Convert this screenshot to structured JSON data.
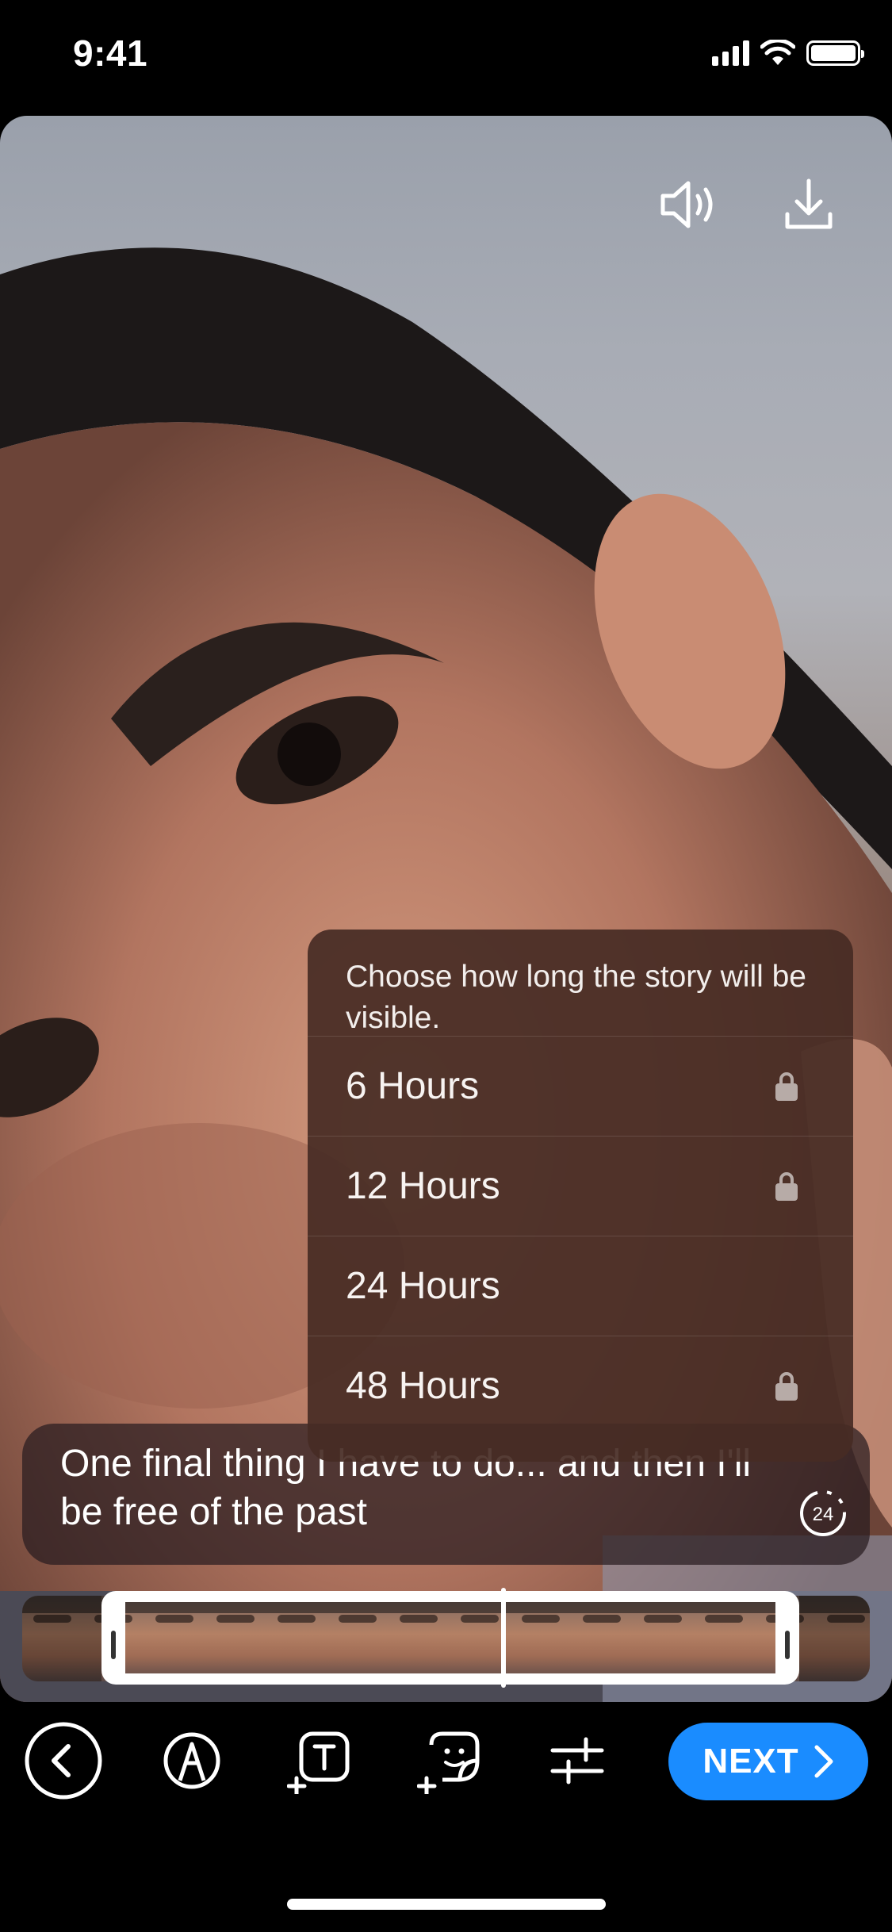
{
  "status_bar": {
    "time": "9:41"
  },
  "media": {
    "sound_icon": "speaker-icon",
    "download_icon": "download-icon"
  },
  "duration_menu": {
    "title": "Choose how long the story will be visible.",
    "options": [
      {
        "label": "6 Hours",
        "locked": true
      },
      {
        "label": "12 Hours",
        "locked": true
      },
      {
        "label": "24 Hours",
        "locked": false
      },
      {
        "label": "48 Hours",
        "locked": true
      }
    ]
  },
  "caption": {
    "text": "One final thing I have to do... and then I'll be free of the past",
    "timer_badge": "24"
  },
  "timeline": {
    "thumbnail_count": 14
  },
  "toolbar": {
    "next_label": "NEXT",
    "accent_color": "#1a8cff"
  }
}
